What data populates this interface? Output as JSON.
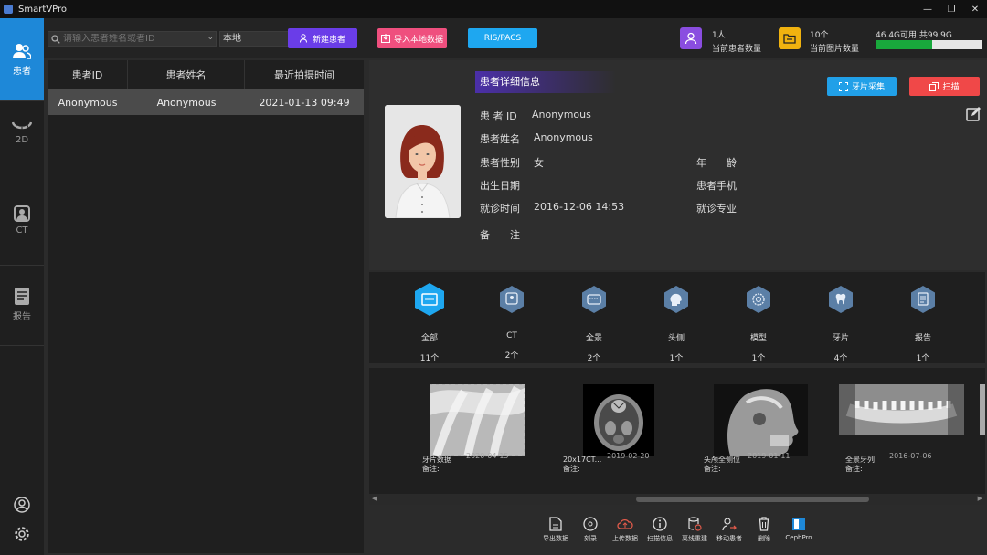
{
  "app": {
    "title": "SmartVPro"
  },
  "window": {
    "minimize": "—",
    "restore": "❐",
    "close": "✕"
  },
  "sidebar": {
    "items": [
      {
        "label": "患者",
        "icon": "patient-icon",
        "active": true
      },
      {
        "label": "2D",
        "icon": "dental-arch-icon"
      },
      {
        "label": "CT",
        "icon": "ct-scanner-icon"
      },
      {
        "label": "报告",
        "icon": "report-icon"
      }
    ],
    "bottom_icons": [
      "user-icon",
      "settings-icon"
    ]
  },
  "toolbar": {
    "search_placeholder": "请输入患者姓名或者ID",
    "source": "本地",
    "new_patient": "新建患者",
    "import_local": "导入本地数据",
    "ris_pacs": "RIS/PACS",
    "patient_count": "1人",
    "patient_count_label": "当前患者数量",
    "image_count": "10个",
    "image_count_label": "当前图片数量",
    "storage_text": "46.4G可用  共99.9G",
    "storage_used_fraction": 0.535,
    "colors": {
      "new_patient": "#6a3de8",
      "import_local": "#ef4f7e",
      "ris_pacs": "#1ea7f0",
      "storage": "#19a83c"
    }
  },
  "patient_list": {
    "columns": [
      "患者ID",
      "患者姓名",
      "最近拍摄时间"
    ],
    "rows": [
      [
        "Anonymous",
        "Anonymous",
        "2021-01-13 09:49"
      ]
    ]
  },
  "detail": {
    "header": "患者详细信息",
    "collect_button": "牙片采集",
    "scan_button": "扫描",
    "fields": {
      "id_label": "患 者  ID",
      "id_value": "Anonymous",
      "name_label": "患者姓名",
      "name_value": "Anonymous",
      "gender_label": "患者性别",
      "gender_value": "女",
      "age_label": "年　　龄",
      "birth_label": "出生日期",
      "phone_label": "患者手机",
      "visit_label": "就诊时间",
      "visit_value": "2016-12-06 14:53",
      "specialty_label": "就诊专业",
      "notes_label": "备　　注"
    }
  },
  "categories": [
    {
      "name": "全部",
      "count": "11个",
      "icon": "all-images-icon",
      "active": true
    },
    {
      "name": "CT",
      "count": "2个",
      "icon": "ct-icon"
    },
    {
      "name": "全景",
      "count": "2个",
      "icon": "panoramic-icon"
    },
    {
      "name": "头侧",
      "count": "1个",
      "icon": "cephalometric-icon"
    },
    {
      "name": "模型",
      "count": "1个",
      "icon": "model-icon"
    },
    {
      "name": "牙片",
      "count": "4个",
      "icon": "tooth-icon"
    },
    {
      "name": "报告",
      "count": "1个",
      "icon": "report-icon"
    }
  ],
  "images": [
    {
      "name": "牙片数据",
      "date": "2020-04-15",
      "note": "备注:"
    },
    {
      "name": "20x17CT...",
      "date": "2019-02-20",
      "note": "备注:"
    },
    {
      "name": "头颅全侧位",
      "date": "2019-01-11",
      "note": "备注:"
    },
    {
      "name": "全景牙列",
      "date": "2016-07-06",
      "note": "备注:"
    }
  ],
  "actions": [
    {
      "label": "导出数据",
      "icon": "export-icon"
    },
    {
      "label": "刻录",
      "icon": "disc-burn-icon"
    },
    {
      "label": "上传数据",
      "icon": "cloud-upload-icon"
    },
    {
      "label": "扫描信息",
      "icon": "info-icon"
    },
    {
      "label": "离线重建",
      "icon": "rebuild-icon"
    },
    {
      "label": "移动患者",
      "icon": "move-patient-icon"
    },
    {
      "label": "删除",
      "icon": "trash-icon"
    },
    {
      "label": "CephPro",
      "icon": "cephpro-icon"
    }
  ]
}
